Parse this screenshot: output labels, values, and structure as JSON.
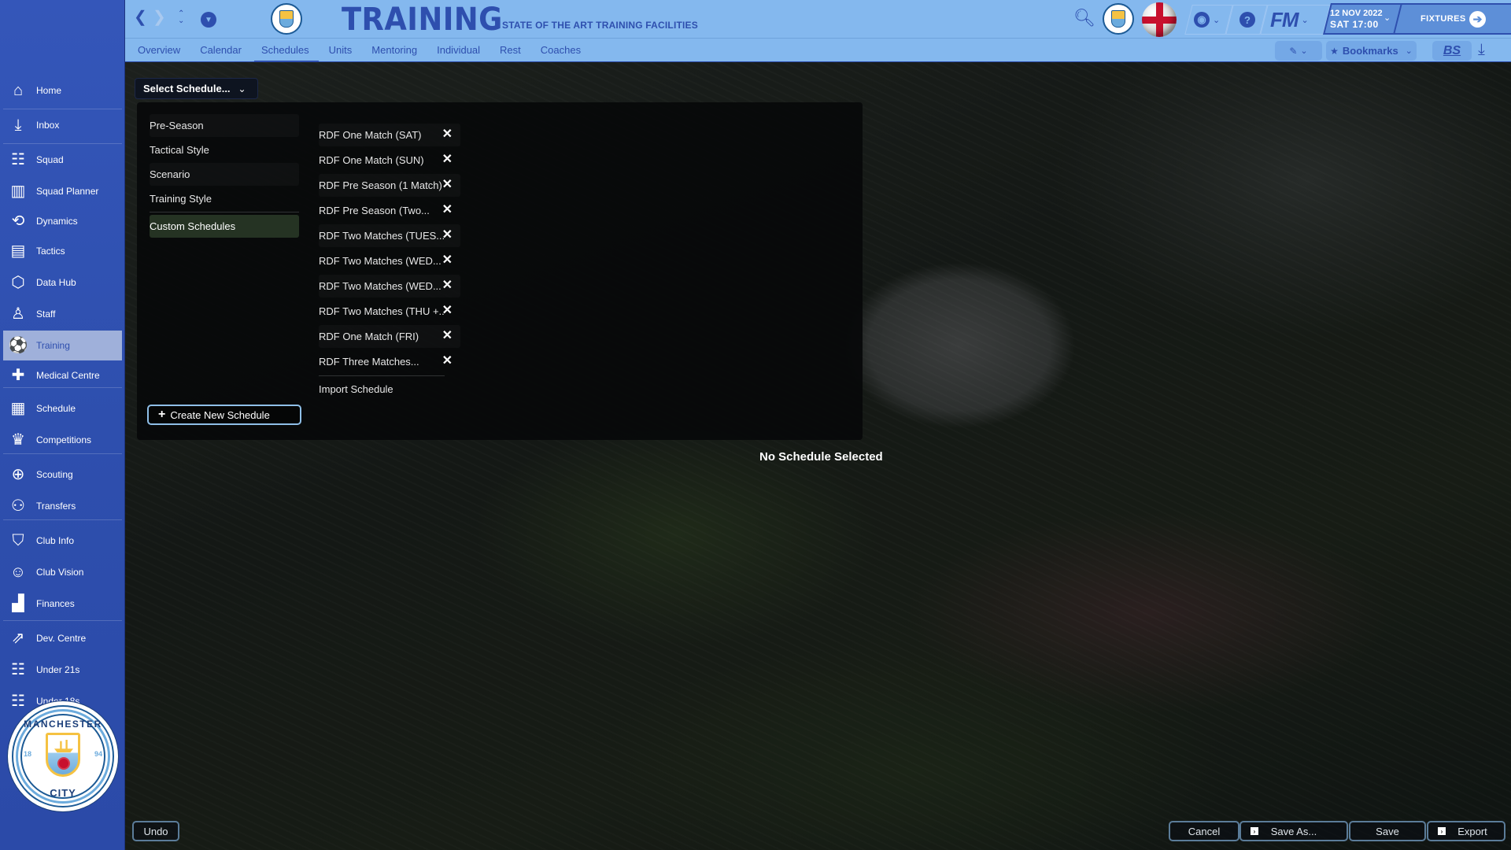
{
  "sidebar": {
    "items": [
      {
        "label": "Home",
        "icon": "house-icon",
        "glyph": "⌂"
      },
      {
        "label": "Inbox",
        "icon": "inbox-tray-icon",
        "glyph": "⤓"
      },
      {
        "label": "Squad",
        "icon": "squad-players-icon",
        "glyph": "☷"
      },
      {
        "label": "Squad Planner",
        "icon": "presentation-board-icon",
        "glyph": "▥"
      },
      {
        "label": "Dynamics",
        "icon": "people-cycle-icon",
        "glyph": "⟲"
      },
      {
        "label": "Tactics",
        "icon": "pitch-icon",
        "glyph": "▤"
      },
      {
        "label": "Data Hub",
        "icon": "data-hub-shape-icon",
        "glyph": "⬡"
      },
      {
        "label": "Staff",
        "icon": "coach-whistle-icon",
        "glyph": "♙"
      },
      {
        "label": "Training",
        "icon": "ball-cone-icon",
        "glyph": "⚽"
      },
      {
        "label": "Medical Centre",
        "icon": "medical-kit-icon",
        "glyph": "✚"
      },
      {
        "label": "Schedule",
        "icon": "calendar-clock-icon",
        "glyph": "▦"
      },
      {
        "label": "Competitions",
        "icon": "trophy-icon",
        "glyph": "♛"
      },
      {
        "label": "Scouting",
        "icon": "globe-magnifier-icon",
        "glyph": "⊕"
      },
      {
        "label": "Transfers",
        "icon": "handshake-icon",
        "glyph": "⚇"
      },
      {
        "label": "Club Info",
        "icon": "shield-icon",
        "glyph": "⛉"
      },
      {
        "label": "Club Vision",
        "icon": "person-vision-icon",
        "glyph": "☺"
      },
      {
        "label": "Finances",
        "icon": "finance-chart-icon",
        "glyph": "▟"
      },
      {
        "label": "Dev. Centre",
        "icon": "development-arrows-icon",
        "glyph": "⇗"
      },
      {
        "label": "Under 21s",
        "icon": "u21-squad-icon",
        "glyph": "☷"
      },
      {
        "label": "Under 18s",
        "icon": "u18-squad-icon",
        "glyph": "☷"
      }
    ],
    "active_index": 8,
    "club_crest": {
      "top": "MANCHESTER",
      "bottom": "CITY",
      "year_left": "18",
      "year_right": "94"
    }
  },
  "header": {
    "title": "TRAINING",
    "subtitle": "STATE OF THE ART TRAINING FACILITIES",
    "date_line1": "12 NOV 2022",
    "date_line2": "SAT 17:00",
    "fixtures_label": "FIXTURES",
    "fm_label": "FM",
    "bs_label": "BS",
    "bookmarks_label": "Bookmarks"
  },
  "tabs": [
    {
      "label": "Overview"
    },
    {
      "label": "Calendar"
    },
    {
      "label": "Schedules"
    },
    {
      "label": "Units"
    },
    {
      "label": "Mentoring"
    },
    {
      "label": "Individual"
    },
    {
      "label": "Rest"
    },
    {
      "label": "Coaches"
    }
  ],
  "active_tab": "Schedules",
  "schedules": {
    "select_label": "Select Schedule...",
    "categories": [
      {
        "label": "Pre-Season"
      },
      {
        "label": "Tactical Style"
      },
      {
        "label": "Scenario"
      },
      {
        "label": "Training Style"
      },
      {
        "label": "Custom Schedules"
      }
    ],
    "active_category": "Custom Schedules",
    "custom_items": [
      {
        "label": "RDF One Match (SAT)"
      },
      {
        "label": "RDF One Match (SUN)"
      },
      {
        "label": "RDF Pre Season (1 Match)"
      },
      {
        "label": "RDF Pre Season (Two..."
      },
      {
        "label": "RDF Two Matches (TUES..."
      },
      {
        "label": "RDF Two Matches (WED..."
      },
      {
        "label": "RDF Two Matches (WED..."
      },
      {
        "label": "RDF Two Matches (THU +..."
      },
      {
        "label": "RDF One Match (FRI)"
      },
      {
        "label": "RDF Three Matches..."
      }
    ],
    "remove_glyph": "✕",
    "import_label": "Import Schedule",
    "create_label": "Create New Schedule",
    "create_glyph": "+",
    "empty_message": "No Schedule Selected"
  },
  "footer": {
    "undo_label": "Undo",
    "cancel_label": "Cancel",
    "save_as_label": "Save As...",
    "save_label": "Save",
    "export_label": "Export"
  },
  "colors": {
    "sidebar_bg": "#2e4fae",
    "header_bg": "#84b8ee",
    "accent": "#2e4fae",
    "active_category_bg": "#253323",
    "button_border": "#8fbfe8"
  }
}
